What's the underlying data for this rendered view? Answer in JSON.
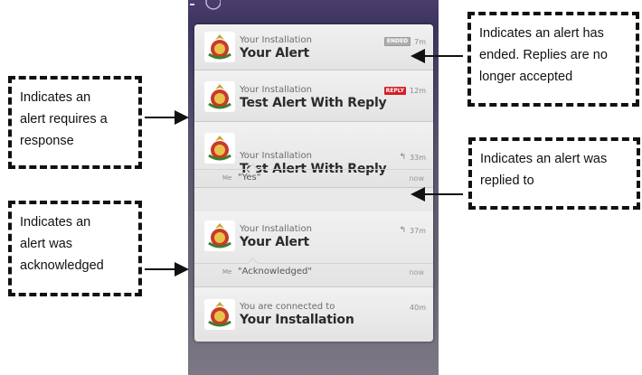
{
  "notifications": [
    {
      "source": "Your Installation",
      "title": "Your Alert",
      "tag": "ENDED",
      "time": "7m",
      "icon": "army-crest-icon"
    },
    {
      "source": "Your Installation",
      "title": "Test Alert With Reply",
      "tag": "REPLY",
      "time": "12m",
      "icon": "army-crest-icon"
    },
    {
      "source": "Your Installation",
      "title": "Test Alert With Reply",
      "time": "33m",
      "status_icon": "reply-arrow-icon",
      "reply": {
        "sender": "Me",
        "message": "\"Yes\"",
        "when": "now"
      },
      "icon": "army-crest-icon"
    },
    {
      "source": "Your Installation",
      "title": "Your Alert",
      "time": "37m",
      "status_icon": "reply-arrow-icon",
      "reply": {
        "sender": "Me",
        "message": "\"Acknowledged\"",
        "when": "now"
      },
      "icon": "army-crest-icon"
    },
    {
      "source": "You are connected to",
      "title": "Your Installation",
      "time": "40m",
      "icon": "army-crest-icon"
    }
  ],
  "callouts": {
    "ended": [
      "Indicates an alert has",
      "ended. Replies are no",
      "longer accepted"
    ],
    "requires_response": [
      "Indicates an",
      "alert requires a",
      "response"
    ],
    "replied": [
      "Indicates an alert was",
      "replied to"
    ],
    "acknowledged": [
      "Indicates an",
      "alert was",
      "acknowledged"
    ]
  },
  "icons": {
    "reply_arrow_glyph": "↰"
  },
  "colors": {
    "reply_tag": "#d41f26",
    "ended_tag": "#b0b0b0"
  }
}
